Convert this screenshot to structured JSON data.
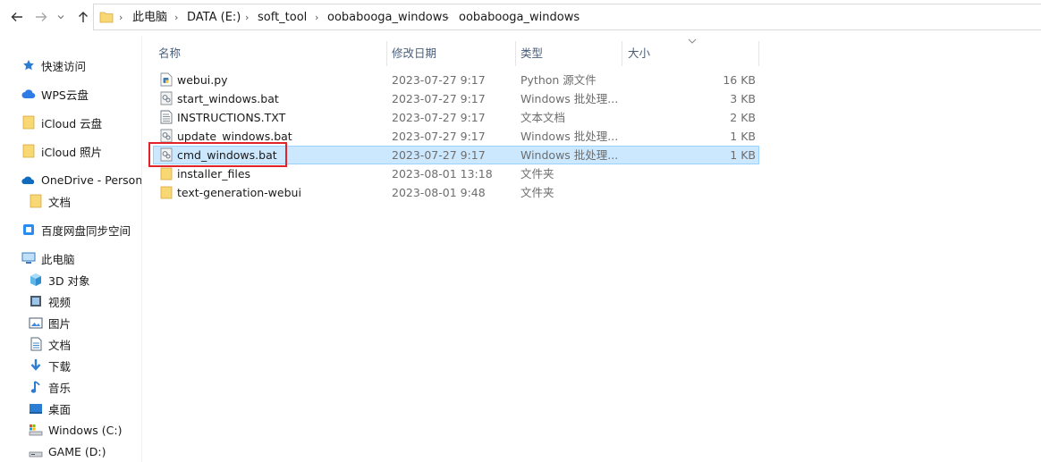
{
  "address": {
    "crumbs": [
      "此电脑",
      "DATA (E:)",
      "soft_tool",
      "oobabooga_windows",
      "oobabooga_windows"
    ]
  },
  "nav": {
    "items": [
      {
        "label": "快速访问",
        "icon": "star-icon"
      },
      {
        "label": "WPS云盘",
        "icon": "cloud-icon"
      },
      {
        "label": "iCloud 云盘",
        "icon": "folder-icon"
      },
      {
        "label": "iCloud 照片",
        "icon": "folder-icon"
      },
      {
        "label": "OneDrive - Persona",
        "icon": "onedrive-icon"
      },
      {
        "label": "文档",
        "icon": "folder-icon"
      },
      {
        "label": "百度网盘同步空间",
        "icon": "baidu-sync-icon"
      },
      {
        "label": "此电脑",
        "icon": "computer-icon"
      },
      {
        "label": "3D 对象",
        "icon": "cube-3d-icon"
      },
      {
        "label": "视频",
        "icon": "video-icon"
      },
      {
        "label": "图片",
        "icon": "picture-icon"
      },
      {
        "label": "文档",
        "icon": "document-icon"
      },
      {
        "label": "下载",
        "icon": "download-icon"
      },
      {
        "label": "音乐",
        "icon": "music-icon"
      },
      {
        "label": "桌面",
        "icon": "desktop-icon"
      },
      {
        "label": "Windows (C:)",
        "icon": "drive-icon"
      },
      {
        "label": "GAME (D:)",
        "icon": "drive-icon"
      }
    ]
  },
  "columns": {
    "name": "名称",
    "date": "修改日期",
    "type": "类型",
    "size": "大小"
  },
  "files": [
    {
      "name": "webui.py",
      "date": "2023-07-27 9:17",
      "type": "Python 源文件",
      "size": "16 KB",
      "icon": "python-file-icon"
    },
    {
      "name": "start_windows.bat",
      "date": "2023-07-27 9:17",
      "type": "Windows 批处理...",
      "size": "3 KB",
      "icon": "batch-file-icon"
    },
    {
      "name": "INSTRUCTIONS.TXT",
      "date": "2023-07-27 9:17",
      "type": "文本文档",
      "size": "2 KB",
      "icon": "text-file-icon"
    },
    {
      "name": "update_windows.bat",
      "date": "2023-07-27 9:17",
      "type": "Windows 批处理...",
      "size": "1 KB",
      "icon": "batch-file-icon"
    },
    {
      "name": "cmd_windows.bat",
      "date": "2023-07-27 9:17",
      "type": "Windows 批处理...",
      "size": "1 KB",
      "icon": "batch-file-icon",
      "selected": true
    },
    {
      "name": "installer_files",
      "date": "2023-08-01 13:18",
      "type": "文件夹",
      "size": "",
      "icon": "folder-icon"
    },
    {
      "name": "text-generation-webui",
      "date": "2023-08-01 9:48",
      "type": "文件夹",
      "size": "",
      "icon": "folder-icon"
    }
  ],
  "colors": {
    "selection_bg": "#cce8ff",
    "selection_border": "#99d1ff",
    "highlight": "#e0242a",
    "folder": "#f8d775"
  }
}
